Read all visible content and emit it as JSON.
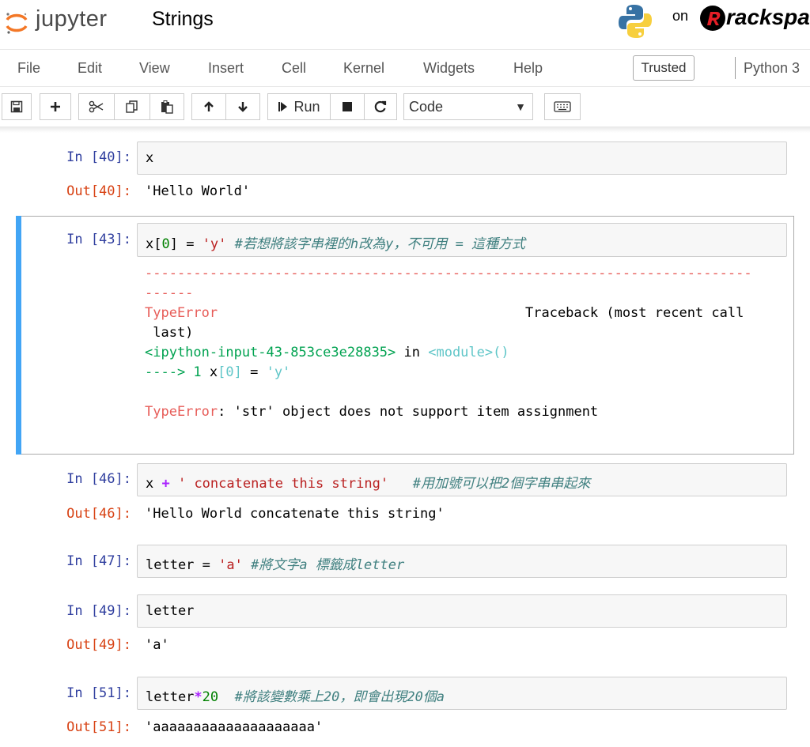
{
  "header": {
    "logo_text": "jupyter",
    "notebook_title": "Strings",
    "on_label": "on",
    "rackspace_text": "rackspace"
  },
  "menu": {
    "items": [
      "File",
      "Edit",
      "View",
      "Insert",
      "Cell",
      "Kernel",
      "Widgets",
      "Help"
    ],
    "trusted": "Trusted",
    "kernel": "Python 3"
  },
  "toolbar": {
    "run_label": "Run",
    "cell_type": "Code"
  },
  "cells": {
    "c40": {
      "in": "In [40]:",
      "code": "x",
      "out": "Out[40]:",
      "result": "'Hello World'"
    },
    "c43": {
      "in": "In [43]:",
      "code_var": "x[",
      "code_idx": "0",
      "code_mid": "] = ",
      "code_str": "'y'",
      "code_comment": " #若想將該字串裡的h改為y，不可用 = 這種方式",
      "err_dashes1": "---------------------------------------------------------------------------",
      "err_dashes2": "------",
      "err_type": "TypeError",
      "err_traceback": "Traceback (most recent call",
      "err_last": " last)",
      "err_input": "<ipython-input-43-853ce3e28835>",
      "err_in": " in ",
      "err_module": "<module>",
      "err_paren": "()",
      "err_arrow": "----> 1 ",
      "err_code_x": "x",
      "err_code_idx": "[0]",
      "err_code_eq": " = ",
      "err_code_str": "'y'",
      "err_final_type": "TypeError",
      "err_final_msg": ": 'str' object does not support item assignment"
    },
    "c46": {
      "in": "In [46]:",
      "code_x": "x ",
      "code_op": "+",
      "code_str": " ' concatenate this string'",
      "code_comment": "   #用加號可以把2個字串串起來",
      "out": "Out[46]:",
      "result": "'Hello World concatenate this string'"
    },
    "c47": {
      "in": "In [47]:",
      "code_a": "letter = ",
      "code_str": "'a'",
      "code_comment": " #將文字a 標籤成letter"
    },
    "c49": {
      "in": "In [49]:",
      "code": "letter",
      "out": "Out[49]:",
      "result": "'a'"
    },
    "c51": {
      "in": "In [51]:",
      "code_a": "letter",
      "code_op": "*",
      "code_num": "20",
      "code_comment": "  #將該變數乘上20，即會出現20個a",
      "out": "Out[51]:",
      "result": "'aaaaaaaaaaaaaaaaaaaa'"
    }
  },
  "colors": {
    "in_prompt": "#303f9f",
    "out_prompt": "#d84315",
    "selected_bar": "#42a5f5",
    "string": "#ba2121",
    "comment": "#408080"
  }
}
